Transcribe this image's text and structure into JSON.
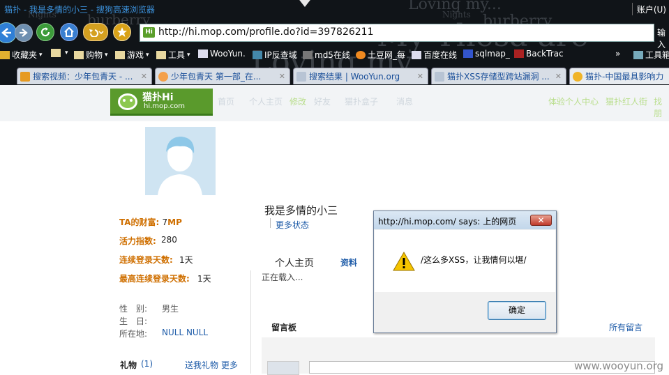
{
  "browser": {
    "window_title": "猫扑 - 我是多情的小三 - 搜狗高速浏览器",
    "account_label": "账户(U)",
    "url": "http://hi.mop.com/profile.do?id=397826211",
    "input_label": "输入",
    "bg_text": [
      "Loving my...",
      "Nights",
      "burberry",
      "My Thesa are",
      "Nights",
      "burberry",
      "Loving my..."
    ],
    "bookmarks": [
      "收藏夹",
      "",
      "购物",
      "游戏",
      "工具",
      "WooYun.",
      "IP反查域",
      "md5在线",
      "土豆网_每",
      "百度在线",
      "sqlmap_",
      "BackTrac",
      "»",
      "工具箱"
    ],
    "tabs": [
      {
        "label": "搜索视频：少年包青天 - ..."
      },
      {
        "label": "少年包青天 第一部_在..."
      },
      {
        "label": "搜索结果 | WooYun.org"
      },
      {
        "label": "猫扑XSS存储型跨站漏洞 ..."
      },
      {
        "label": "猫扑-中国最具影响力"
      }
    ]
  },
  "site": {
    "logo_cn": "猫扑Hi",
    "logo_url": "hi.mop.com",
    "nav": [
      "首页",
      "个人主页",
      "修改",
      "好友",
      "猫扑盒子",
      "消息"
    ],
    "nav_right": [
      "体验个人中心",
      "猫扑红人街",
      "找朋"
    ]
  },
  "profile": {
    "name": "我是多情的小三",
    "more_status": "更多状态",
    "tab_home": "个人主页",
    "tab_info": "资料",
    "loading": "正在载入...",
    "wealth_label": "TA的财富:",
    "wealth_value": "7",
    "wealth_unit": "MP",
    "energy_label": "活力指数:",
    "energy_value": "280",
    "streak_label": "连续登录天数:",
    "streak_value": "1天",
    "max_streak_label": "最高连续登录天数:",
    "max_streak_value": "1天",
    "gender_label": "性　别:",
    "gender_value": "男生",
    "birthday_label": "生　日:",
    "location_label": "所在地:",
    "location_value": "NULL NULL",
    "gifts_label": "礼物",
    "gifts_count": "(1)",
    "send_gift": "送我礼物",
    "more": "更多",
    "board_title": "留言板",
    "all_messages": "所有留言"
  },
  "dialog": {
    "title": "http://hi.mop.com/ says: 上的网页",
    "close": "✕",
    "message": "/这么多XSS，让我情何以堪/",
    "ok": "确定"
  },
  "watermark": "www.wooyun.org"
}
